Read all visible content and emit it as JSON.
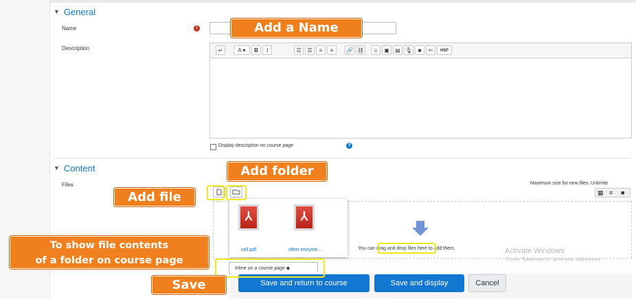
{
  "general": {
    "title": "General",
    "name_label": "Name",
    "description_label": "Description",
    "display_description": "Display description on course page"
  },
  "editor_toolbar": [
    "↵",
    "A ▾",
    "B",
    "I",
    "☰",
    "☰",
    "≡",
    "≡",
    "🔗",
    "⛓",
    "☺",
    "▣",
    "▤",
    "🎙",
    "■",
    "✄",
    "H5P"
  ],
  "content": {
    "title": "Content",
    "files_label": "Files",
    "max_size": "Maximum size for new files: Unlimite",
    "drop_text_before": "You can",
    "drop_text_highlight": "drag and drop files",
    "drop_text_after": "here to add them.",
    "files": [
      "cell.pdf",
      "other enzyme..."
    ],
    "display_select": "Inline on a course page ◆"
  },
  "buttons": {
    "save_return": "Save and return to course",
    "save_display": "Save and display",
    "cancel": "Cancel"
  },
  "callouts": {
    "add_name": "Add a Name",
    "add_folder": "Add folder",
    "add_file": "Add file",
    "show_contents": "To show file contents\nof a folder on course page",
    "save": "Save"
  },
  "watermark": {
    "line1": "Activate Windows",
    "line2": "Go to Settings to activate Windows."
  },
  "icons": [
    "chevron-down-icon",
    "required-icon",
    "help-icon",
    "file-add-icon",
    "folder-add-icon",
    "grid-view-icon",
    "list-view-icon",
    "tree-view-icon",
    "download-arrow-icon",
    "pdf-file-icon"
  ],
  "colors": {
    "accent": "#1177d1",
    "callout": "#f0801e",
    "highlight": "#f3e81f",
    "required": "#ca3120"
  }
}
